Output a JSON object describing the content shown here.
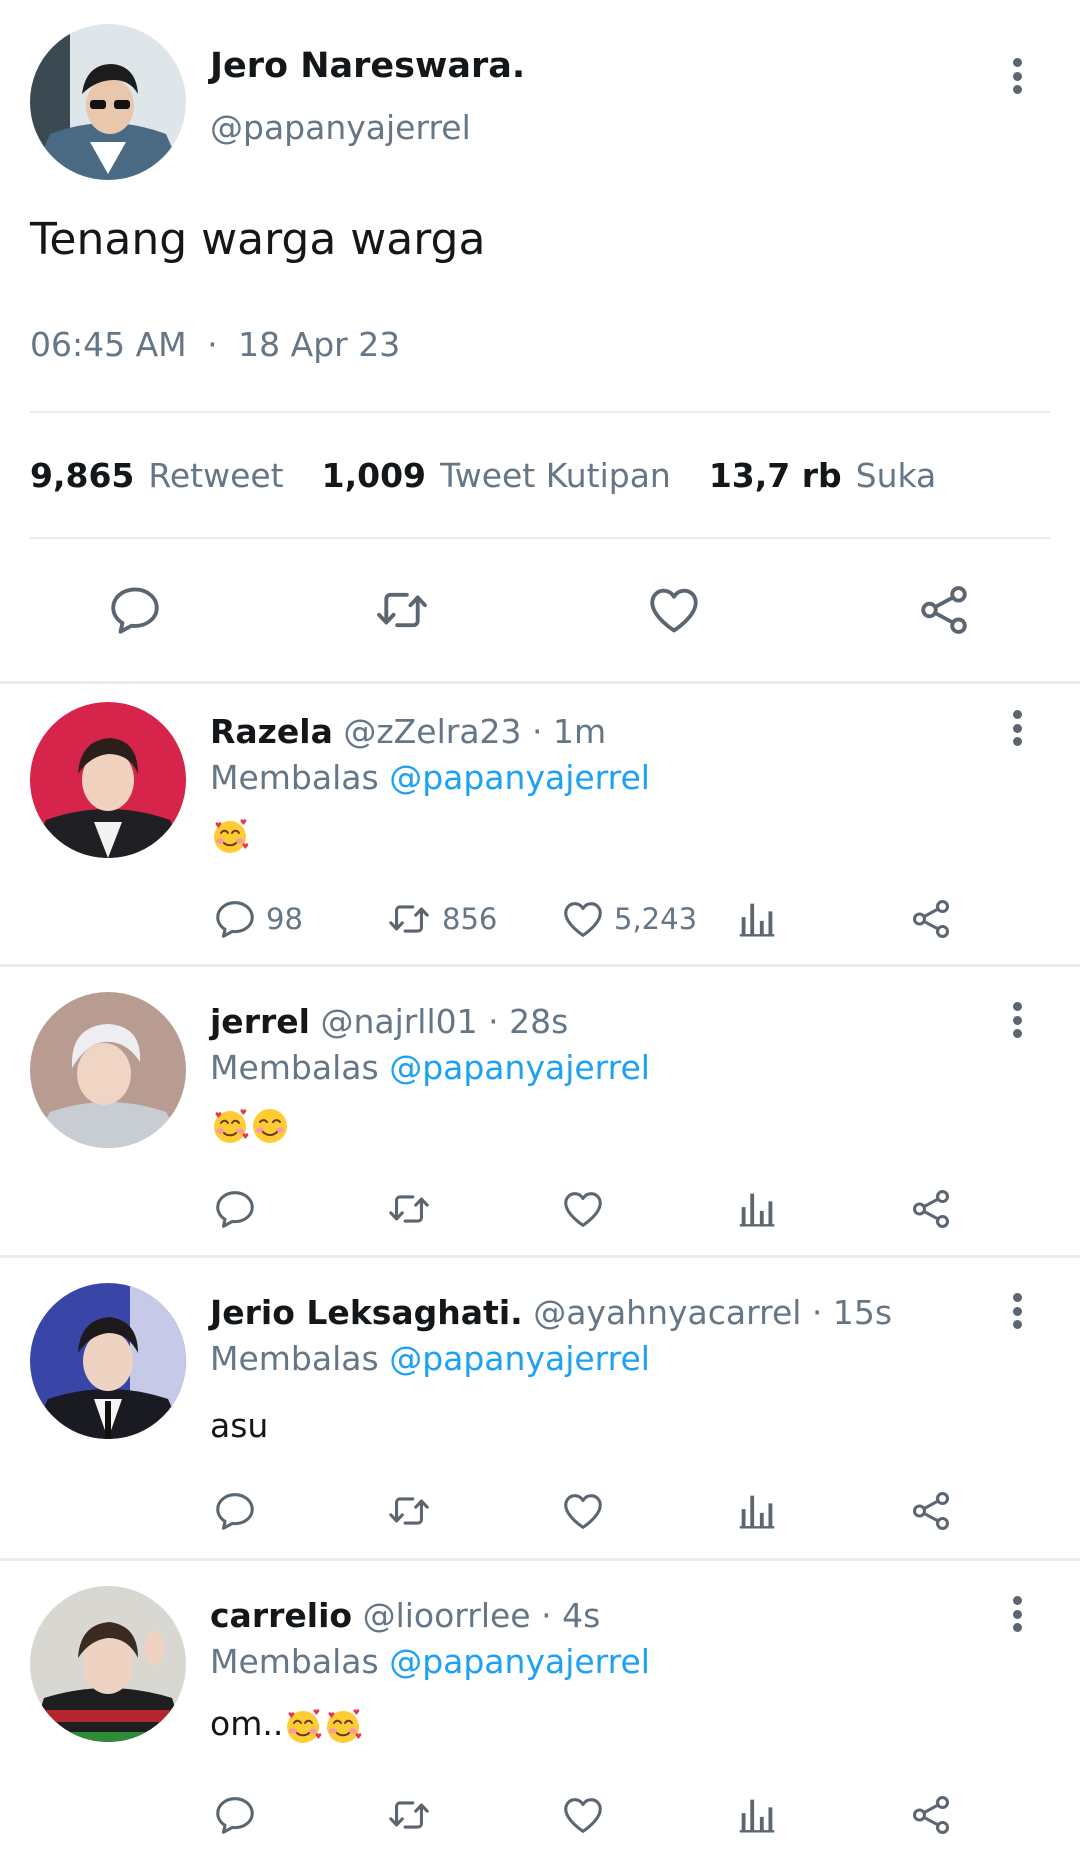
{
  "main_tweet": {
    "name": "Jero Nareswara.",
    "handle": "@papanyajerrel",
    "text": "Tenang warga warga",
    "time": "06:45 AM",
    "separator": "·",
    "date": "18 Apr 23",
    "stats": [
      {
        "value": "9,865",
        "label": "Retweet"
      },
      {
        "value": "1,009",
        "label": "Tweet Kutipan"
      },
      {
        "value": "13,7 rb",
        "label": "Suka"
      }
    ],
    "actions": [
      "reply-icon",
      "retweet-icon",
      "like-icon",
      "share-icon"
    ],
    "menu_icon": "more-vertical-icon"
  },
  "replies": [
    {
      "name": "Razela",
      "handle": "@zZelra23",
      "time": "· 1m",
      "replying_prefix": "Membalas",
      "replying_to": "@papanyajerrel",
      "text": "",
      "emojis": [
        "smiling-face-with-hearts"
      ],
      "counts": {
        "reply": "98",
        "retweet": "856",
        "like": "5,243"
      }
    },
    {
      "name": "jerrel",
      "handle": "@najrll01",
      "time": "· 28s",
      "replying_prefix": "Membalas",
      "replying_to": "@papanyajerrel",
      "text": "",
      "emojis": [
        "smiling-face-with-hearts",
        "smiling-face"
      ],
      "counts": {
        "reply": "",
        "retweet": "",
        "like": ""
      }
    },
    {
      "name": "Jerio Leksaghati.",
      "handle": "@ayahnyacarrel",
      "time": "· 15s",
      "replying_prefix": "Membalas",
      "replying_to": "@papanyajerrel",
      "text": "asu",
      "emojis": [],
      "counts": {
        "reply": "",
        "retweet": "",
        "like": ""
      }
    },
    {
      "name": "carrelio",
      "handle": "@lioorrlee",
      "time": "· 4s",
      "replying_prefix": "Membalas",
      "replying_to": "@papanyajerrel",
      "text": "om..",
      "emojis": [
        "smiling-face-with-hearts",
        "smiling-face-with-hearts"
      ],
      "counts": {
        "reply": "",
        "retweet": "",
        "like": ""
      }
    }
  ],
  "colors": {
    "text": "#14171a",
    "muted": "#657786",
    "link": "#1da1f2",
    "divider": "#e6ecf0"
  }
}
